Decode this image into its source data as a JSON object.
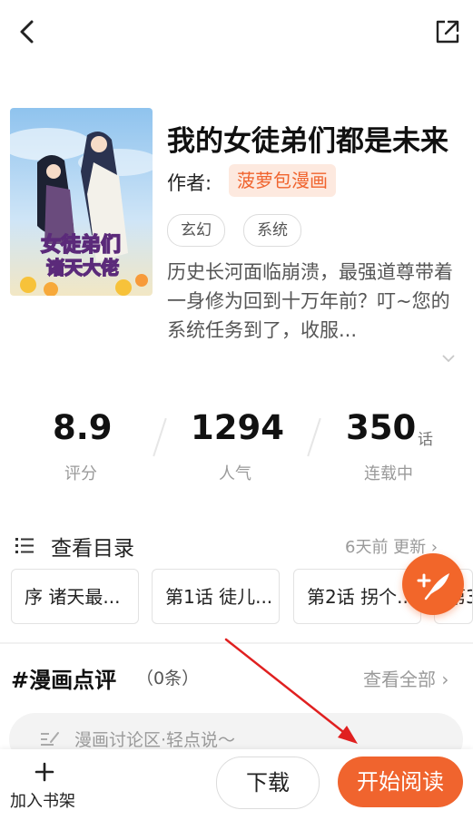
{
  "header": {
    "back_icon": "chevron-left-icon",
    "share_icon": "share-external-icon"
  },
  "comic": {
    "title": "我的女徒弟们都是未来",
    "cover_text": "女徒弟们 诸天大佬",
    "author_label": "作者:",
    "author_name": "菠萝包漫画",
    "tags": [
      "玄幻",
      "系统"
    ],
    "description": "历史长河面临崩溃，最强道尊带着一身修为回到十万年前？叮~您的系统任务到了，收服...",
    "expand_icon": "chevron-down-icon"
  },
  "stats": {
    "rating": {
      "value": "8.9",
      "label": "评分"
    },
    "popularity": {
      "value": "1294",
      "label": "人气"
    },
    "chapters": {
      "value": "350",
      "unit": "话",
      "label": "连载中"
    }
  },
  "catalog": {
    "title": "查看目录",
    "update": "6天前 更新 ›",
    "chapters": [
      "序 诸天最...",
      "第1话 徒儿...",
      "第2话 拐个...",
      "第3"
    ]
  },
  "review": {
    "title": "#漫画点评",
    "count": "（0条）",
    "view_all": "查看全部 ›",
    "input_placeholder": "漫画讨论区·轻点说～"
  },
  "bottom": {
    "shelf_label": "加入书架",
    "download_label": "下载",
    "read_label": "开始阅读"
  },
  "colors": {
    "accent": "#f0642e",
    "accent_light": "#fde9df",
    "annotation_arrow": "#e02020"
  }
}
